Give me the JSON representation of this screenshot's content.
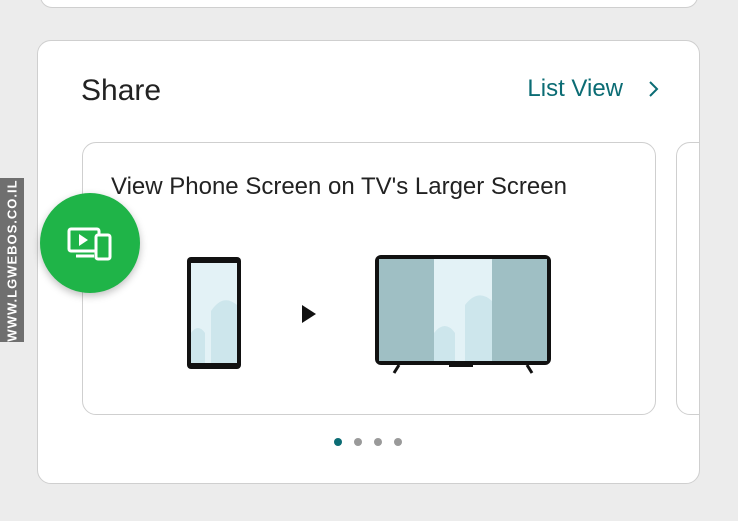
{
  "share": {
    "title": "Share",
    "list_view_label": "List View",
    "chevron_icon": "chevron-right-icon"
  },
  "carousel": {
    "cards": [
      {
        "title": "View Phone Screen on TV's Larger Screen",
        "illustration": [
          "phone-icon",
          "play-arrow-icon",
          "tv-icon"
        ]
      }
    ],
    "page_count": 4,
    "active_page": 1
  },
  "fab": {
    "icon": "screen-share-icon"
  },
  "watermark": {
    "text": "WWW.LGWEBOS.CO.IL"
  },
  "colors": {
    "accent": "#0b6c74",
    "fab_green": "#1fb448",
    "illustration_teal": "#9fbfc4",
    "illustration_light": "#e3f2f6"
  }
}
